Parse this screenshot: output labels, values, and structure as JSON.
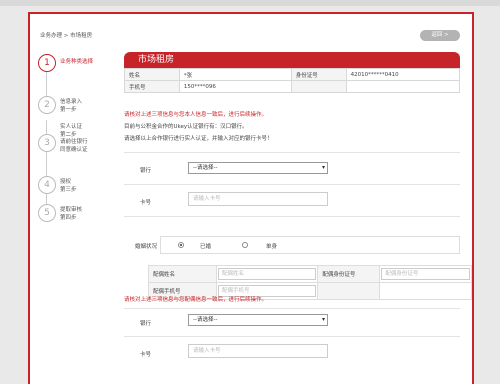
{
  "breadcrumb": "业务办理 > 市场租房",
  "back_button": "返回 >",
  "steps": [
    {
      "num": "1",
      "lines": [
        "业务种类选择"
      ],
      "active": true
    },
    {
      "num": "2",
      "lines": [
        "信息录入",
        "第一步"
      ],
      "active": false
    },
    {
      "num": "3",
      "lines": [
        "实人认证",
        "第二步",
        "请前往银行",
        "同意确认证"
      ],
      "active": false
    },
    {
      "num": "4",
      "lines": [
        "授权",
        "第三步"
      ],
      "active": false
    },
    {
      "num": "5",
      "lines": [
        "提取审核",
        "第四步"
      ],
      "active": false
    }
  ],
  "section_title": "市场租房",
  "info": {
    "name_label": "姓名",
    "name_value": "*张",
    "id_label": "身份证号",
    "id_value": "42010******0410",
    "phone_label": "手机号",
    "phone_value": "150****096"
  },
  "warning1": "请核对上述三项信息与您本人信息一致后，进行后续操作。",
  "note1": "目前与公积金合作的Ukey认证银行有：汉口银行。",
  "note2": "请选择以上合作银行进行实人认证，并输入对应的银行卡号！",
  "bank_label": "银行",
  "bank_select": "--请选择--",
  "card_label": "卡号",
  "card_placeholder": "请输入卡号",
  "marital": {
    "label": "婚姻状况",
    "opt_married": "已婚",
    "opt_single": "单身"
  },
  "spouse": {
    "name_label": "配偶姓名",
    "name_placeholder": "配偶姓名",
    "id_label": "配偶身份证号",
    "id_placeholder": "配偶身份证号",
    "phone_label": "配偶手机号",
    "phone_placeholder": "配偶手机号"
  },
  "warning2": "请核对上述三项信息与您配偶信息一致后，进行后续操作。",
  "bank2_label": "银行",
  "bank2_select": "--请选择--",
  "card2_label": "卡号",
  "card2_placeholder": "请输入卡号",
  "colors": {
    "accent": "#c7242a"
  }
}
